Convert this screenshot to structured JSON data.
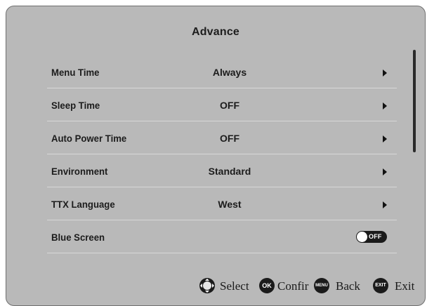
{
  "menu": {
    "title": "Advance",
    "items": [
      {
        "label": "Menu Time",
        "value": "Always",
        "type": "submenu"
      },
      {
        "label": "Sleep Time",
        "value": "OFF",
        "type": "submenu"
      },
      {
        "label": "Auto Power Time",
        "value": "OFF",
        "type": "submenu"
      },
      {
        "label": "Environment",
        "value": "Standard",
        "type": "submenu"
      },
      {
        "label": "TTX Language",
        "value": "West",
        "type": "submenu"
      },
      {
        "label": "Blue Screen",
        "value": "OFF",
        "type": "toggle",
        "on": false
      }
    ]
  },
  "footer": {
    "select": {
      "icon": "dpad-icon",
      "label": "Select"
    },
    "confirm": {
      "icon": "ok-button-icon",
      "icon_text": "OK",
      "label": "Confir"
    },
    "back": {
      "icon": "menu-button-icon",
      "icon_text": "MENU",
      "label": "Back"
    },
    "exit": {
      "icon": "exit-button-icon",
      "icon_text": "EXIT",
      "label": "Exit"
    }
  },
  "colors": {
    "panel_background": "#b9b9b9",
    "text": "#1c1c1c",
    "toggle_off": "#1a1a1a"
  }
}
